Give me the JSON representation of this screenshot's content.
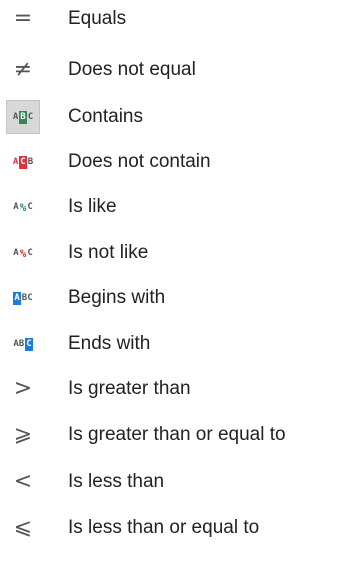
{
  "menu": {
    "items": [
      {
        "label": "Equals",
        "icon": "equals-icon",
        "glyph": "="
      },
      {
        "label": "Does not equal",
        "icon": "not-equal-icon",
        "glyph": "≠"
      },
      {
        "label": "Contains",
        "icon": "contains-icon",
        "selected": true
      },
      {
        "label": "Does not contain",
        "icon": "does-not-contain-icon"
      },
      {
        "label": "Is like",
        "icon": "is-like-icon"
      },
      {
        "label": "Is not like",
        "icon": "is-not-like-icon"
      },
      {
        "label": "Begins with",
        "icon": "begins-with-icon"
      },
      {
        "label": "Ends with",
        "icon": "ends-with-icon"
      },
      {
        "label": "Is greater than",
        "icon": "greater-than-icon",
        "glyph": ">"
      },
      {
        "label": "Is greater than or equal to",
        "icon": "greater-or-equal-icon",
        "glyph": "⩾"
      },
      {
        "label": "Is less than",
        "icon": "less-than-icon",
        "glyph": "<"
      },
      {
        "label": "Is less than or equal to",
        "icon": "less-or-equal-icon",
        "glyph": "⩽"
      }
    ]
  },
  "colors": {
    "contains_green": "#2e8b57",
    "not_red": "#d9363e",
    "blue": "#1c7cd6",
    "selected_bg": "#d8d8d8"
  }
}
